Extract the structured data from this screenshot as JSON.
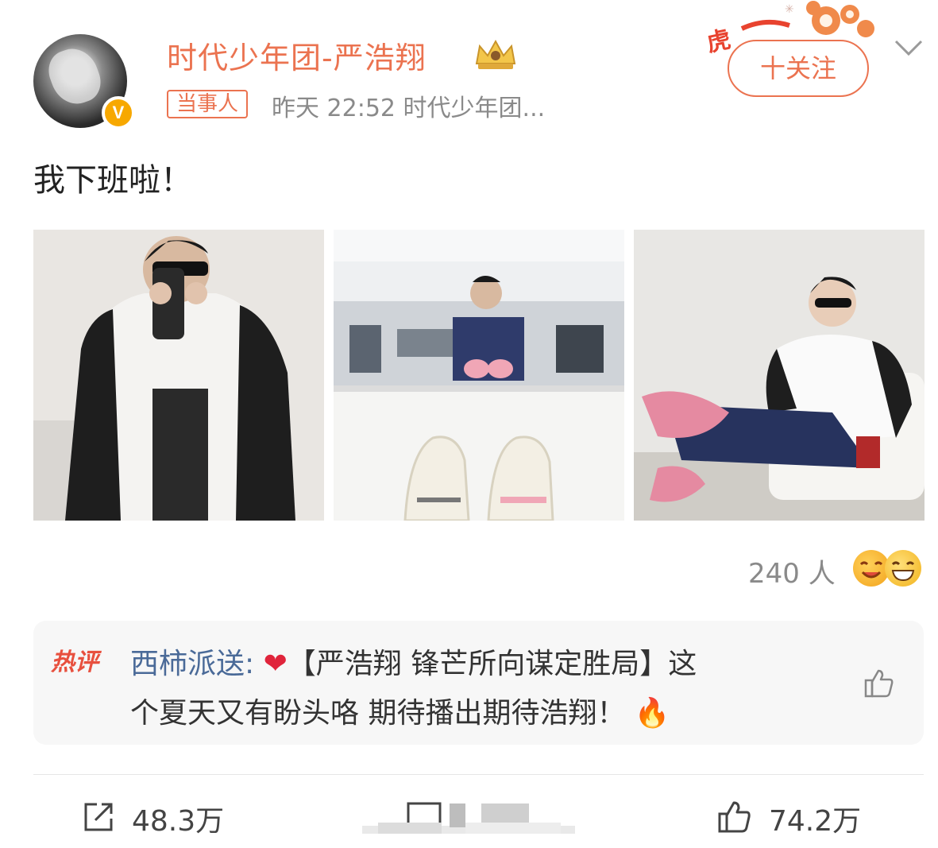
{
  "post": {
    "username": "时代少年团-严浩翔",
    "tag": "当事人",
    "time_source": "昨天 22:52  时代少年团...",
    "follow_label": "十关注",
    "text": "我下班啦！"
  },
  "reactions": {
    "count_label": "240 人"
  },
  "hot_comment": {
    "badge": "热评",
    "commenter": "西柿派送:",
    "line1_text": "【严浩翔 锋芒所向谋定胜局】这",
    "line2_text": "个夏天又有盼头咯 期待播出期待浩翔！"
  },
  "actions": {
    "share_count": "48.3万",
    "like_count": "74.2万"
  },
  "colors": {
    "accent": "#eb7350",
    "commenter": "#4a6a98",
    "muted": "#8a8a8a"
  },
  "icons": [
    "crown-icon",
    "verified-icon",
    "chevron-down-icon",
    "like-icon",
    "share-icon",
    "comment-icon",
    "heart-emoji",
    "fire-emoji",
    "laugh-emoji"
  ]
}
